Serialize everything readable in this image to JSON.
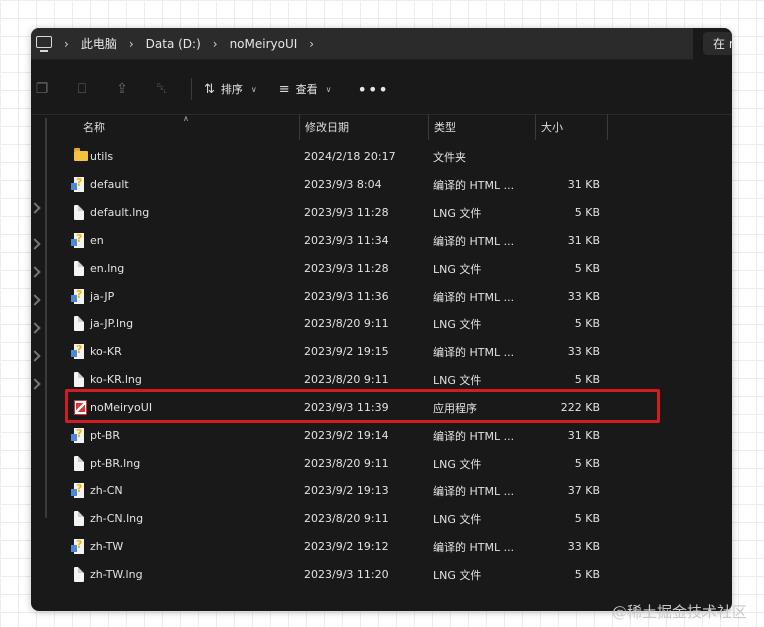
{
  "address": {
    "crumbs": [
      "此电脑",
      "Data (D:)",
      "noMeiryoUI"
    ],
    "search_partial": "在 n"
  },
  "toolbar": {
    "sort_label": "排序",
    "view_label": "查看"
  },
  "columns": {
    "name": "名称",
    "date": "修改日期",
    "type": "类型",
    "size": "大小"
  },
  "rows": [
    {
      "name": "utils",
      "date": "2024/2/18 20:17",
      "type": "文件夹",
      "size": "",
      "icon": "folder"
    },
    {
      "name": "default",
      "date": "2023/9/3 8:04",
      "type": "编译的 HTML ...",
      "size": "31 KB",
      "icon": "chm"
    },
    {
      "name": "default.lng",
      "date": "2023/9/3 11:28",
      "type": "LNG 文件",
      "size": "5 KB",
      "icon": "doc"
    },
    {
      "name": "en",
      "date": "2023/9/3 11:34",
      "type": "编译的 HTML ...",
      "size": "31 KB",
      "icon": "chm"
    },
    {
      "name": "en.lng",
      "date": "2023/9/3 11:28",
      "type": "LNG 文件",
      "size": "5 KB",
      "icon": "doc"
    },
    {
      "name": "ja-JP",
      "date": "2023/9/3 11:36",
      "type": "编译的 HTML ...",
      "size": "33 KB",
      "icon": "chm"
    },
    {
      "name": "ja-JP.lng",
      "date": "2023/8/20 9:11",
      "type": "LNG 文件",
      "size": "5 KB",
      "icon": "doc"
    },
    {
      "name": "ko-KR",
      "date": "2023/9/2 19:15",
      "type": "编译的 HTML ...",
      "size": "33 KB",
      "icon": "chm"
    },
    {
      "name": "ko-KR.lng",
      "date": "2023/8/20 9:11",
      "type": "LNG 文件",
      "size": "5 KB",
      "icon": "doc"
    },
    {
      "name": "noMeiryoUI",
      "date": "2023/9/3 11:39",
      "type": "应用程序",
      "size": "222 KB",
      "icon": "app"
    },
    {
      "name": "pt-BR",
      "date": "2023/9/2 19:14",
      "type": "编译的 HTML ...",
      "size": "31 KB",
      "icon": "chm"
    },
    {
      "name": "pt-BR.lng",
      "date": "2023/8/20 9:11",
      "type": "LNG 文件",
      "size": "5 KB",
      "icon": "doc"
    },
    {
      "name": "zh-CN",
      "date": "2023/9/2 19:13",
      "type": "编译的 HTML ...",
      "size": "37 KB",
      "icon": "chm"
    },
    {
      "name": "zh-CN.lng",
      "date": "2023/8/20 9:11",
      "type": "LNG 文件",
      "size": "5 KB",
      "icon": "doc"
    },
    {
      "name": "zh-TW",
      "date": "2023/9/2 19:12",
      "type": "编译的 HTML ...",
      "size": "33 KB",
      "icon": "chm"
    },
    {
      "name": "zh-TW.lng",
      "date": "2023/9/3 11:20",
      "type": "LNG 文件",
      "size": "5 KB",
      "icon": "doc"
    }
  ],
  "highlighted_row": "noMeiryoUI",
  "highlight_color": "#d21c23",
  "watermark": "@稀土掘金技术社区"
}
